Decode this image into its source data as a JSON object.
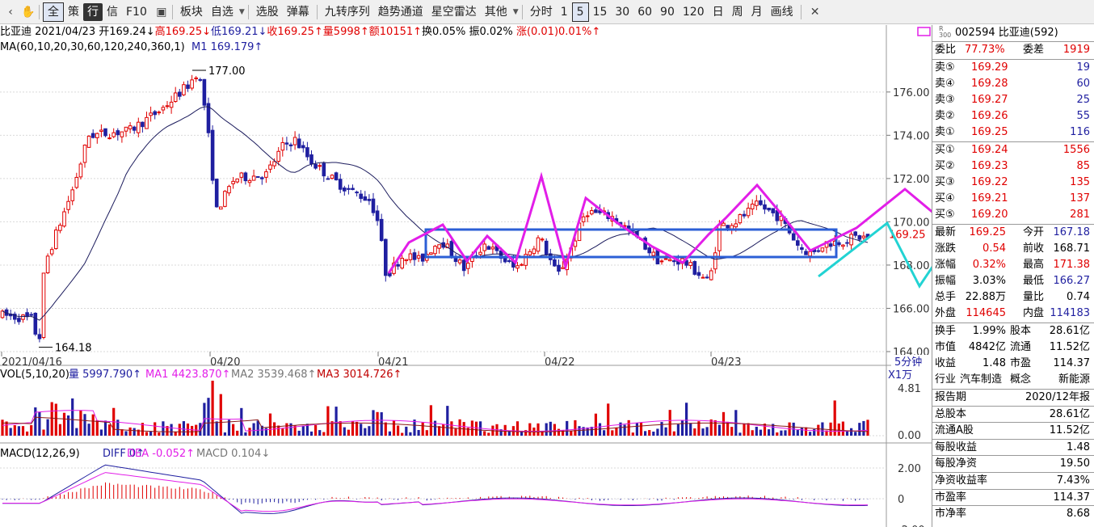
{
  "toolbar": {
    "items": [
      {
        "label": "全",
        "style": "box"
      },
      {
        "label": "策",
        "style": ""
      },
      {
        "label": "行",
        "style": "sel"
      },
      {
        "label": "信",
        "style": ""
      },
      {
        "label": "F10",
        "style": ""
      },
      {
        "label": "板块",
        "style": ""
      },
      {
        "label": "自选",
        "style": "",
        "caret": true
      },
      {
        "label": "选股",
        "style": ""
      },
      {
        "label": "弹幕",
        "style": ""
      },
      {
        "label": "九转序列",
        "style": ""
      },
      {
        "label": "趋势通道",
        "style": ""
      },
      {
        "label": "星空雷达",
        "style": ""
      },
      {
        "label": "其他",
        "style": "",
        "caret": true
      },
      {
        "label": "分时",
        "style": ""
      },
      {
        "label": "1",
        "style": ""
      },
      {
        "label": "5",
        "style": "box"
      },
      {
        "label": "15",
        "style": ""
      },
      {
        "label": "30",
        "style": ""
      },
      {
        "label": "60",
        "style": ""
      },
      {
        "label": "90",
        "style": ""
      },
      {
        "label": "120",
        "style": ""
      },
      {
        "label": "日",
        "style": ""
      },
      {
        "label": "周",
        "style": ""
      },
      {
        "label": "月",
        "style": ""
      },
      {
        "label": "画线",
        "style": ""
      }
    ]
  },
  "header": {
    "name": "比亚迪",
    "date": "2021/04/23",
    "open": "开169.24↓",
    "high": "高169.25↓",
    "low": "低169.21↓",
    "close": "收169.25↑",
    "vol": "量5998↑",
    "amount": "额10151↑",
    "turnover": "换0.05%",
    "amplitude": "振0.02%",
    "change": "涨(0.01)0.01%↑"
  },
  "ma_line": {
    "params": "MA(60,10,20,30,60,120,240,360,1)",
    "m1": "M1 169.179↑"
  },
  "price_axis": [
    "176.00",
    "174.00",
    "172.00",
    "170.00",
    "168.00",
    "166.00",
    "164.00"
  ],
  "price_range": [
    164.0,
    177.6
  ],
  "labels": {
    "high_mark": "177.00",
    "low_mark": "164.18",
    "last_price": "169.25",
    "period": "5分钟"
  },
  "x_dates": [
    "2021/04/16",
    "04/20",
    "04/21",
    "04/22",
    "04/23"
  ],
  "vol_info": {
    "title": "VOL(5,10,20)",
    "vol": "量 5997.790↑",
    "ma1": "MA1 4423.870↑",
    "ma2": "MA2 3539.468↑",
    "ma3": "MA3 3014.726↑",
    "unit": "X1万",
    "axis": [
      "4.81",
      "0.00"
    ]
  },
  "macd_info": {
    "title": "MACD(12,26,9)",
    "diff": "DIFF 0↑",
    "dea": "DEA -0.052↑",
    "macd": "MACD 0.104↓",
    "axis": [
      "2.00",
      "0",
      "-2.00"
    ]
  },
  "panel": {
    "code_prefix": "R\n300",
    "title": "002594 比亚迪(592)",
    "ratio": {
      "label": "委比",
      "value": "77.73%",
      "label2": "委差",
      "value2": "1919"
    },
    "asks": [
      {
        "label": "卖⑤",
        "price": "169.29",
        "vol": "19"
      },
      {
        "label": "卖④",
        "price": "169.28",
        "vol": "60"
      },
      {
        "label": "卖③",
        "price": "169.27",
        "vol": "25"
      },
      {
        "label": "卖②",
        "price": "169.26",
        "vol": "55"
      },
      {
        "label": "卖①",
        "price": "169.25",
        "vol": "116"
      }
    ],
    "bids": [
      {
        "label": "买①",
        "price": "169.24",
        "vol": "1556"
      },
      {
        "label": "买②",
        "price": "169.23",
        "vol": "85"
      },
      {
        "label": "买③",
        "price": "169.22",
        "vol": "135"
      },
      {
        "label": "买④",
        "price": "169.21",
        "vol": "137"
      },
      {
        "label": "买⑤",
        "price": "169.20",
        "vol": "281"
      }
    ],
    "quote": [
      {
        "l1": "最新",
        "v1": "169.25",
        "c1": "red",
        "l2": "今开",
        "v2": "167.18",
        "c2": "blue"
      },
      {
        "l1": "涨跌",
        "v1": "0.54",
        "c1": "red",
        "l2": "前收",
        "v2": "168.71",
        "c2": "blk"
      },
      {
        "l1": "涨幅",
        "v1": "0.32%",
        "c1": "red",
        "l2": "最高",
        "v2": "171.38",
        "c2": "red"
      },
      {
        "l1": "振幅",
        "v1": "3.03%",
        "c1": "blk",
        "l2": "最低",
        "v2": "166.27",
        "c2": "blue"
      },
      {
        "l1": "总手",
        "v1": "22.88万",
        "c1": "blk",
        "l2": "量比",
        "v2": "0.74",
        "c2": "blk"
      },
      {
        "l1": "外盘",
        "v1": "114645",
        "c1": "red",
        "l2": "内盘",
        "v2": "114183",
        "c2": "blue"
      }
    ],
    "stats": [
      {
        "l1": "换手",
        "v1": "1.99%",
        "l2": "股本",
        "v2": "28.61亿"
      },
      {
        "l1": "市值",
        "v1": "4842亿",
        "l2": "流通",
        "v2": "11.52亿"
      },
      {
        "l1": "收益",
        "v1": "1.48",
        "l2": "市盈",
        "v2": "114.37"
      }
    ],
    "industry": {
      "l1": "行业",
      "v1": "汽车制造",
      "l2": "概念",
      "v2": "新能源"
    },
    "fin": [
      {
        "label": "报告期",
        "value": "2020/12年报"
      },
      {
        "label": "总股本",
        "value": "28.61亿"
      },
      {
        "label": "流通A股",
        "value": "11.52亿"
      },
      {
        "label": "每股收益",
        "value": "1.48"
      },
      {
        "label": "每股净资",
        "value": "19.50"
      },
      {
        "label": "净资收益率",
        "value": "7.43%"
      },
      {
        "label": "市盈率",
        "value": "114.37"
      },
      {
        "label": "市净率",
        "value": "8.68"
      }
    ]
  },
  "colors": {
    "up": "#e00000",
    "down": "#1f1fa0",
    "ma": "#1a1a5c",
    "box": "#2c5fd6",
    "magenta": "#e21ee8",
    "cyan": "#22d3d3",
    "grid": "#d9d9d9"
  }
}
